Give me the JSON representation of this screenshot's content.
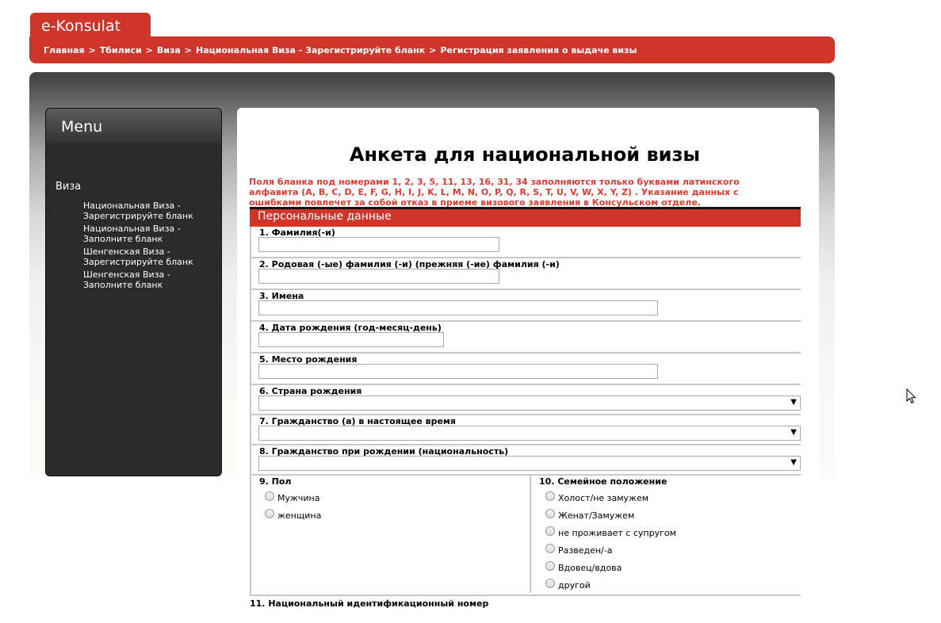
{
  "app": {
    "logo": "e-Konsulat"
  },
  "breadcrumb": {
    "items": [
      "Главная",
      "Тбилиси",
      "Виза",
      "Национальная Виза - Зарегистрируйте бланк",
      "Регистрация заявления о выдаче визы"
    ],
    "separator": ">"
  },
  "menu": {
    "title": "Menu",
    "section": "Виза",
    "items": [
      "Национальная Виза - Зарегистрируйте бланк",
      "Национальная Виза - Заполните бланк",
      "Шенгенская Виза - Зарегистрируйте бланк",
      "Шенгенская Виза - Заполните бланк"
    ]
  },
  "form": {
    "title": "Анкета для национальной визы",
    "warning": "Поля бланка под номерами 1, 2, 3, 5, 11, 13, 16, 31, 34 заполняются только буквами латинского алфавита (A, B, C, D, E, F, G, H, I, J, K, L, M, N, O, P, Q, R, S, T, U, V, W, X, Y, Z) . Указание данных с ошибками повлечет за собой отказ в приеме визового заявления в Консульском отделе.",
    "section": "Персональные данные",
    "fields": {
      "f1": {
        "label": "1. Фамилия(-и)",
        "value": ""
      },
      "f2": {
        "label": "2. Родовая (-ые) фамилия (-и) (прежняя (-ие) фамилия (-и)",
        "value": ""
      },
      "f3": {
        "label": "3. Имена",
        "value": ""
      },
      "f4": {
        "label": "4. Дата рождения (год-месяц-день)",
        "value": ""
      },
      "f5": {
        "label": "5. Место рождения",
        "value": ""
      },
      "f6": {
        "label": "6. Страна рождения",
        "value": ""
      },
      "f7": {
        "label": "7. Гражданство (а) в настоящее время",
        "value": ""
      },
      "f8": {
        "label": "8. Гражданство при рождении (национальность)",
        "value": ""
      },
      "f9": {
        "label": "9. Пол",
        "options": [
          "Мужчина",
          "женщина"
        ]
      },
      "f10": {
        "label": "10. Семейное положение",
        "options": [
          "Холост/не замужем",
          "Женат/Замужем",
          "не проживает с супругом",
          "Разведен/-а",
          "Вдовец/вдова",
          "другой"
        ]
      },
      "f11": {
        "label": "11. Национальный идентификационный номер"
      }
    },
    "select_arrow": "▼"
  }
}
